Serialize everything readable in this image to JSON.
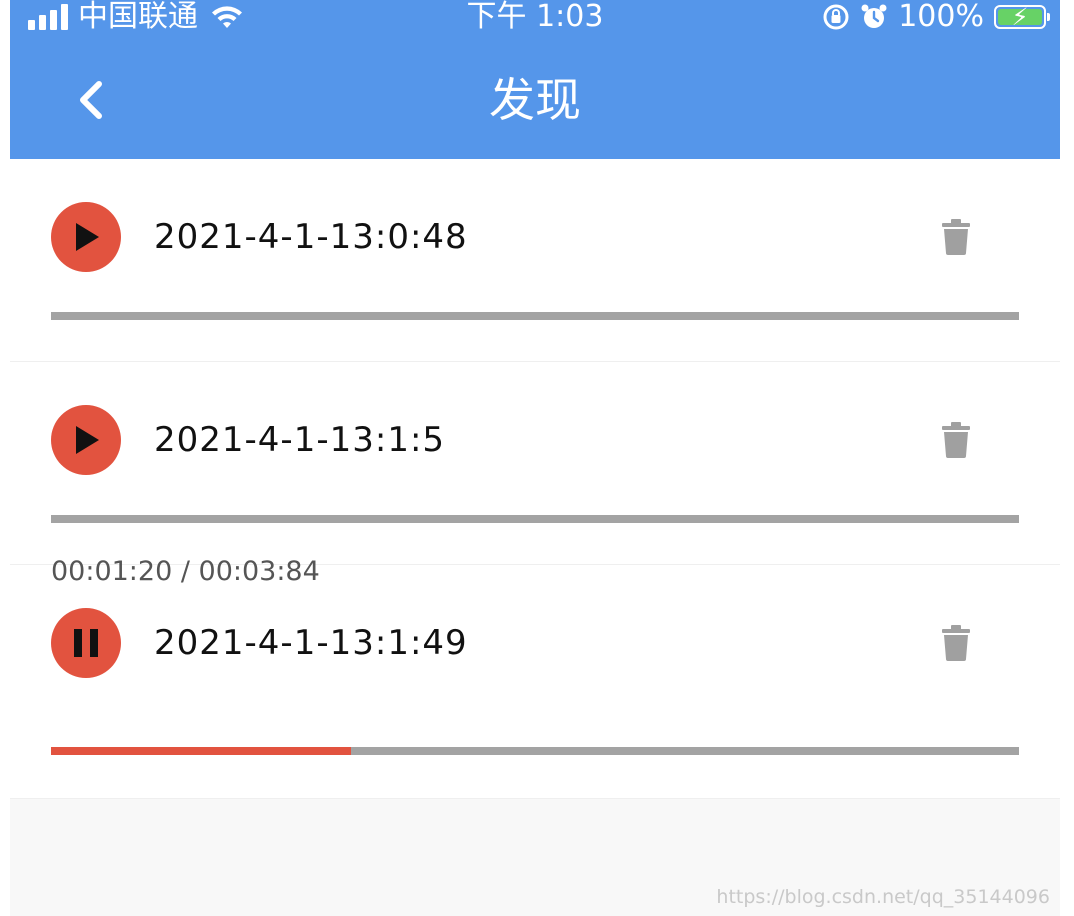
{
  "status_bar": {
    "carrier": "中国联通",
    "time": "下午 1:03",
    "battery_percent": "100%"
  },
  "header": {
    "title": "发现",
    "back_icon": "chevron-left-icon",
    "background_color": "#5596ea"
  },
  "recordings": [
    {
      "name": "2021-4-1-13:0:48",
      "state": "stopped",
      "action_icon": "play-icon",
      "progress": 0
    },
    {
      "name": "2021-4-1-13:1:5",
      "state": "stopped",
      "action_icon": "play-icon",
      "progress": 0
    },
    {
      "name": "2021-4-1-13:1:49",
      "state": "playing",
      "action_icon": "pause-icon",
      "time_readout": "00:01:20 / 00:03:84",
      "progress": 0.31
    }
  ],
  "colors": {
    "accent": "#e2533f",
    "track": "#a3a3a3",
    "trash": "#a0a0a0"
  },
  "watermark": "https://blog.csdn.net/qq_35144096"
}
